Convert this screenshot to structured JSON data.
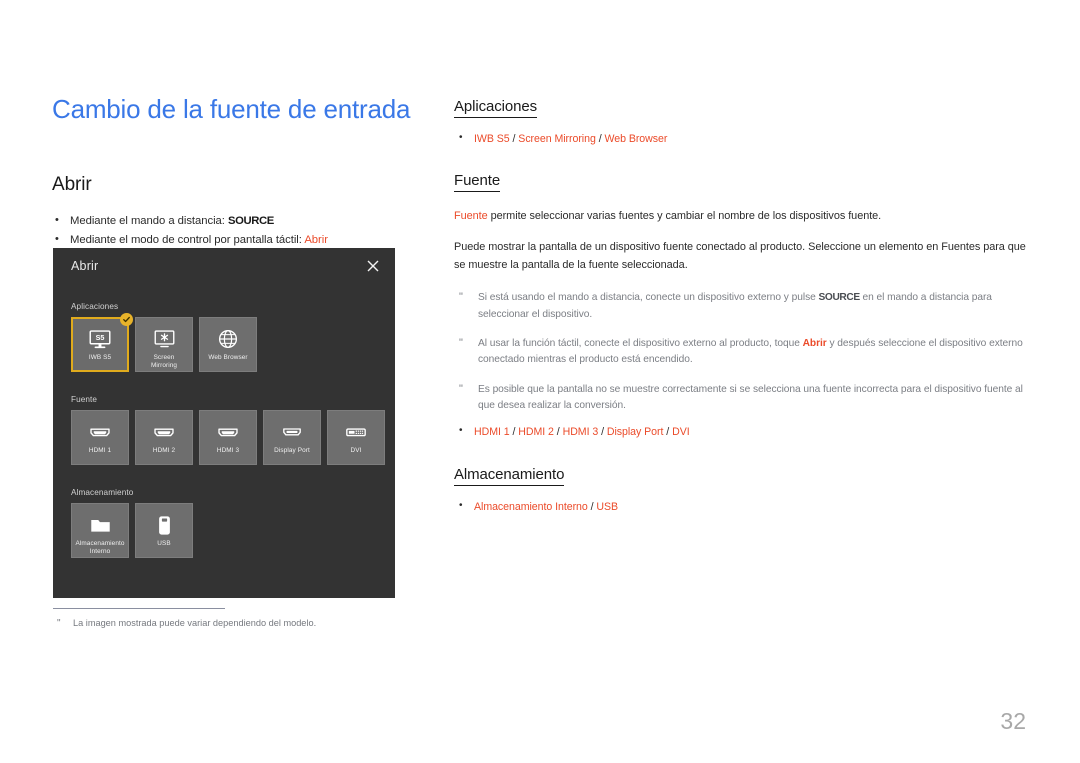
{
  "document": {
    "title": "Cambio de la fuente de entrada",
    "page_number": "32",
    "title_color": "#3a78e7",
    "accent_color": "#eb4b2a",
    "note_color": "#7b7e84"
  },
  "left": {
    "section_title": "Abrir",
    "bullets": [
      {
        "text_before": "Mediante el mando a distancia: ",
        "kbd": "SOURCE",
        "accent": ""
      },
      {
        "text_before": "Mediante el modo de control por pantalla táctil: ",
        "kbd": "",
        "accent": "Abrir"
      }
    ]
  },
  "panel": {
    "title": "Abrir",
    "close_label": "✕",
    "background": "#333333",
    "tile_background": "#6e6e6e",
    "selected_border": "#e0ab1d",
    "groups": [
      {
        "label": "Aplicaciones",
        "tiles": [
          {
            "label": "IWB S5",
            "icon": "monitor-s5-icon",
            "selected": true,
            "badge": "check-badge"
          },
          {
            "label": "Screen\nMirroring",
            "icon": "screen-mirroring-icon",
            "selected": false,
            "badge": ""
          },
          {
            "label": "Web Browser",
            "icon": "globe-icon",
            "selected": false,
            "badge": ""
          }
        ]
      },
      {
        "label": "Fuente",
        "tiles": [
          {
            "label": "HDMI 1",
            "icon": "hdmi-port-icon",
            "selected": false,
            "badge": ""
          },
          {
            "label": "HDMI 2",
            "icon": "hdmi-port-icon",
            "selected": false,
            "badge": ""
          },
          {
            "label": "HDMI 3",
            "icon": "hdmi-port-icon",
            "selected": false,
            "badge": ""
          },
          {
            "label": "Display Port",
            "icon": "displayport-icon",
            "selected": false,
            "badge": ""
          },
          {
            "label": "DVI",
            "icon": "dvi-port-icon",
            "selected": false,
            "badge": ""
          }
        ]
      },
      {
        "label": "Almacenamiento",
        "tiles": [
          {
            "label": "Almacenamiento\nInterno",
            "icon": "folder-icon",
            "selected": false,
            "badge": ""
          },
          {
            "label": "USB",
            "icon": "usb-stick-icon",
            "selected": false,
            "badge": ""
          }
        ]
      }
    ]
  },
  "footnote": {
    "mark": "\"",
    "text": "La imagen mostrada puede variar dependiendo del modelo."
  },
  "right": {
    "aplicaciones": {
      "heading": "Aplicaciones",
      "bullet_parts": [
        "IWB S5",
        "Screen Mirroring",
        "Web Browser"
      ]
    },
    "fuente": {
      "heading": "Fuente",
      "para1_accent": "Fuente",
      "para1_rest": " permite seleccionar varias fuentes y cambiar el nombre de los dispositivos fuente.",
      "para2": "Puede mostrar la pantalla de un dispositivo fuente conectado al producto. Seleccione un elemento en Fuentes para que se muestre la pantalla de la fuente seleccionada.",
      "notes": [
        {
          "mark": "\"",
          "before": "Si está usando el mando a distancia, conecte un dispositivo externo y pulse ",
          "kbd": "SOURCE",
          "after": " en el mando a distancia para seleccionar el dispositivo."
        },
        {
          "mark": "\"",
          "before": "Al usar la función táctil, conecte el dispositivo externo al producto, toque ",
          "accent": "Abrir",
          "after": " y después seleccione el dispositivo externo conectado mientras el producto está encendido."
        },
        {
          "mark": "\"",
          "before": "Es posible que la pantalla no se muestre correctamente si se selecciona una fuente incorrecta para el dispositivo fuente al que desea realizar la conversión.",
          "kbd": "",
          "after": ""
        }
      ],
      "bullet_parts": [
        "HDMI 1",
        "HDMI 2",
        "HDMI 3",
        "Display Port",
        "DVI"
      ]
    },
    "almacenamiento": {
      "heading": "Almacenamiento",
      "bullet_parts": [
        "Almacenamiento Interno",
        "USB"
      ]
    }
  }
}
